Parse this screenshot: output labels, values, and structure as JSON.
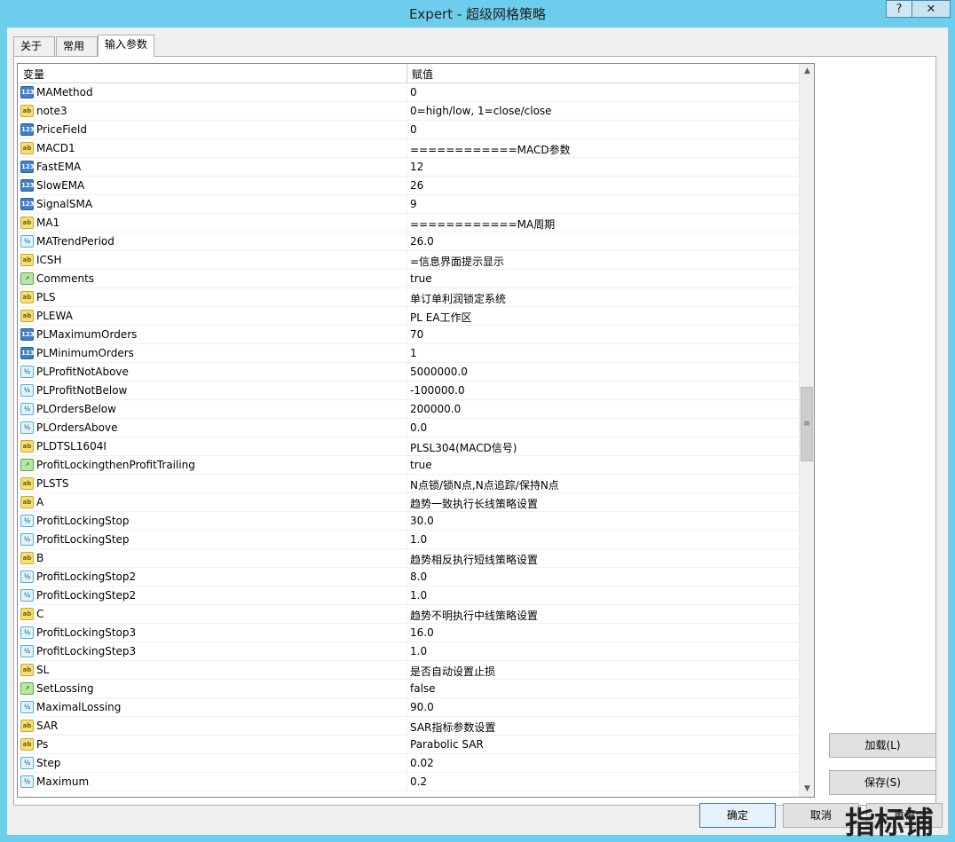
{
  "window": {
    "title": "Expert - 超级网格策略",
    "help_label": "?",
    "close_label": "✕"
  },
  "tabs": [
    {
      "label": "关于"
    },
    {
      "label": "常用"
    },
    {
      "label": "输入参数",
      "active": true
    }
  ],
  "grid": {
    "col_name": "变量",
    "col_value": "赋值",
    "rows": [
      {
        "type": "int",
        "name": "MAMethod",
        "value": "0"
      },
      {
        "type": "str",
        "name": "note3",
        "value": "0=high/low, 1=close/close"
      },
      {
        "type": "int",
        "name": "PriceField",
        "value": "0"
      },
      {
        "type": "str",
        "name": "MACD1",
        "value": "============MACD参数"
      },
      {
        "type": "int",
        "name": "FastEMA",
        "value": "12"
      },
      {
        "type": "int",
        "name": "SlowEMA",
        "value": "26"
      },
      {
        "type": "int",
        "name": "SignalSMA",
        "value": "9"
      },
      {
        "type": "str",
        "name": "MA1",
        "value": "============MA周期"
      },
      {
        "type": "dbl",
        "name": "MATrendPeriod",
        "value": "26.0"
      },
      {
        "type": "str",
        "name": "ICSH",
        "value": "=信息界面提示显示"
      },
      {
        "type": "bool",
        "name": "Comments",
        "value": "true"
      },
      {
        "type": "str",
        "name": "PLS",
        "value": "单订单利润锁定系统"
      },
      {
        "type": "str",
        "name": "PLEWA",
        "value": "PL EA工作区"
      },
      {
        "type": "int",
        "name": "PLMaximumOrders",
        "value": "70"
      },
      {
        "type": "int",
        "name": "PLMinimumOrders",
        "value": "1"
      },
      {
        "type": "dbl",
        "name": "PLProfitNotAbove",
        "value": "5000000.0"
      },
      {
        "type": "dbl",
        "name": "PLProfitNotBelow",
        "value": "-100000.0"
      },
      {
        "type": "dbl",
        "name": "PLOrdersBelow",
        "value": "200000.0"
      },
      {
        "type": "dbl",
        "name": "PLOrdersAbove",
        "value": "0.0"
      },
      {
        "type": "str",
        "name": "PLDTSL1604I",
        "value": "PLSL304(MACD信号)"
      },
      {
        "type": "bool",
        "name": "ProfitLockingthenProfitTrailing",
        "value": "true"
      },
      {
        "type": "str",
        "name": "PLSTS",
        "value": "N点锁/锁N点,N点追踪/保持N点"
      },
      {
        "type": "str",
        "name": "A",
        "value": "趋势一致执行长线策略设置"
      },
      {
        "type": "dbl",
        "name": "ProfitLockingStop",
        "value": "30.0"
      },
      {
        "type": "dbl",
        "name": "ProfitLockingStep",
        "value": "1.0"
      },
      {
        "type": "str",
        "name": "B",
        "value": "趋势相反执行短线策略设置"
      },
      {
        "type": "dbl",
        "name": "ProfitLockingStop2",
        "value": "8.0"
      },
      {
        "type": "dbl",
        "name": "ProfitLockingStep2",
        "value": "1.0"
      },
      {
        "type": "str",
        "name": "C",
        "value": "趋势不明执行中线策略设置"
      },
      {
        "type": "dbl",
        "name": "ProfitLockingStop3",
        "value": "16.0"
      },
      {
        "type": "dbl",
        "name": "ProfitLockingStep3",
        "value": "1.0"
      },
      {
        "type": "str",
        "name": "SL",
        "value": "是否自动设置止损"
      },
      {
        "type": "bool",
        "name": "SetLossing",
        "value": "false"
      },
      {
        "type": "dbl",
        "name": "MaximalLossing",
        "value": "90.0"
      },
      {
        "type": "str",
        "name": "SAR",
        "value": "SAR指标参数设置"
      },
      {
        "type": "str",
        "name": "Ps",
        "value": "Parabolic SAR"
      },
      {
        "type": "dbl",
        "name": "Step",
        "value": "0.02"
      },
      {
        "type": "dbl",
        "name": "Maximum",
        "value": "0.2"
      }
    ]
  },
  "icons": {
    "int": "123",
    "str": "ab",
    "dbl": "½",
    "bool": "↗"
  },
  "buttons": {
    "load": "加载(L)",
    "save": "保存(S)",
    "ok": "确定",
    "cancel": "取消",
    "reset": "重设"
  },
  "watermark": "指标铺"
}
